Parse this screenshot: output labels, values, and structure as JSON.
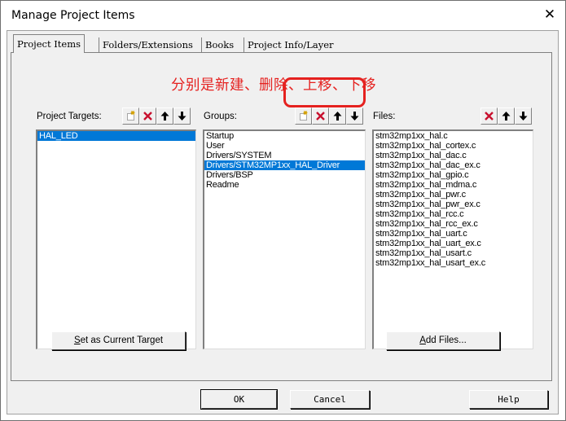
{
  "window": {
    "title": "Manage Project Items",
    "close_glyph": "✕"
  },
  "tabs": [
    {
      "label": "Project Items",
      "active": true
    },
    {
      "label": "Folders/Extensions",
      "active": false
    },
    {
      "label": "Books",
      "active": false
    },
    {
      "label": "Project Info/Layer",
      "active": false
    }
  ],
  "annotation": "分别是新建、删除、上移、下移",
  "targets": {
    "label": "Project Targets:",
    "items": [
      "HAL_LED"
    ],
    "selected_index": 0,
    "set_current_button": "Set as Current Target"
  },
  "groups": {
    "label": "Groups:",
    "items": [
      "Startup",
      "User",
      "Drivers/SYSTEM",
      "Drivers/STM32MP1xx_HAL_Driver",
      "Drivers/BSP",
      "Readme"
    ],
    "selected_index": 3
  },
  "files": {
    "label": "Files:",
    "items": [
      "stm32mp1xx_hal.c",
      "stm32mp1xx_hal_cortex.c",
      "stm32mp1xx_hal_dac.c",
      "stm32mp1xx_hal_dac_ex.c",
      "stm32mp1xx_hal_gpio.c",
      "stm32mp1xx_hal_mdma.c",
      "stm32mp1xx_hal_pwr.c",
      "stm32mp1xx_hal_pwr_ex.c",
      "stm32mp1xx_hal_rcc.c",
      "stm32mp1xx_hal_rcc_ex.c",
      "stm32mp1xx_hal_uart.c",
      "stm32mp1xx_hal_uart_ex.c",
      "stm32mp1xx_hal_usart.c",
      "stm32mp1xx_hal_usart_ex.c"
    ],
    "add_files_button": "Add Files..."
  },
  "footer": {
    "ok": "OK",
    "cancel": "Cancel",
    "help": "Help"
  },
  "icons": {
    "new": "new-item-icon",
    "delete": "delete-icon",
    "up": "move-up-icon",
    "down": "move-down-icon"
  },
  "colors": {
    "selection": "#0078d7",
    "annotation": "#e5211f",
    "delete_icon": "#c8102e"
  }
}
